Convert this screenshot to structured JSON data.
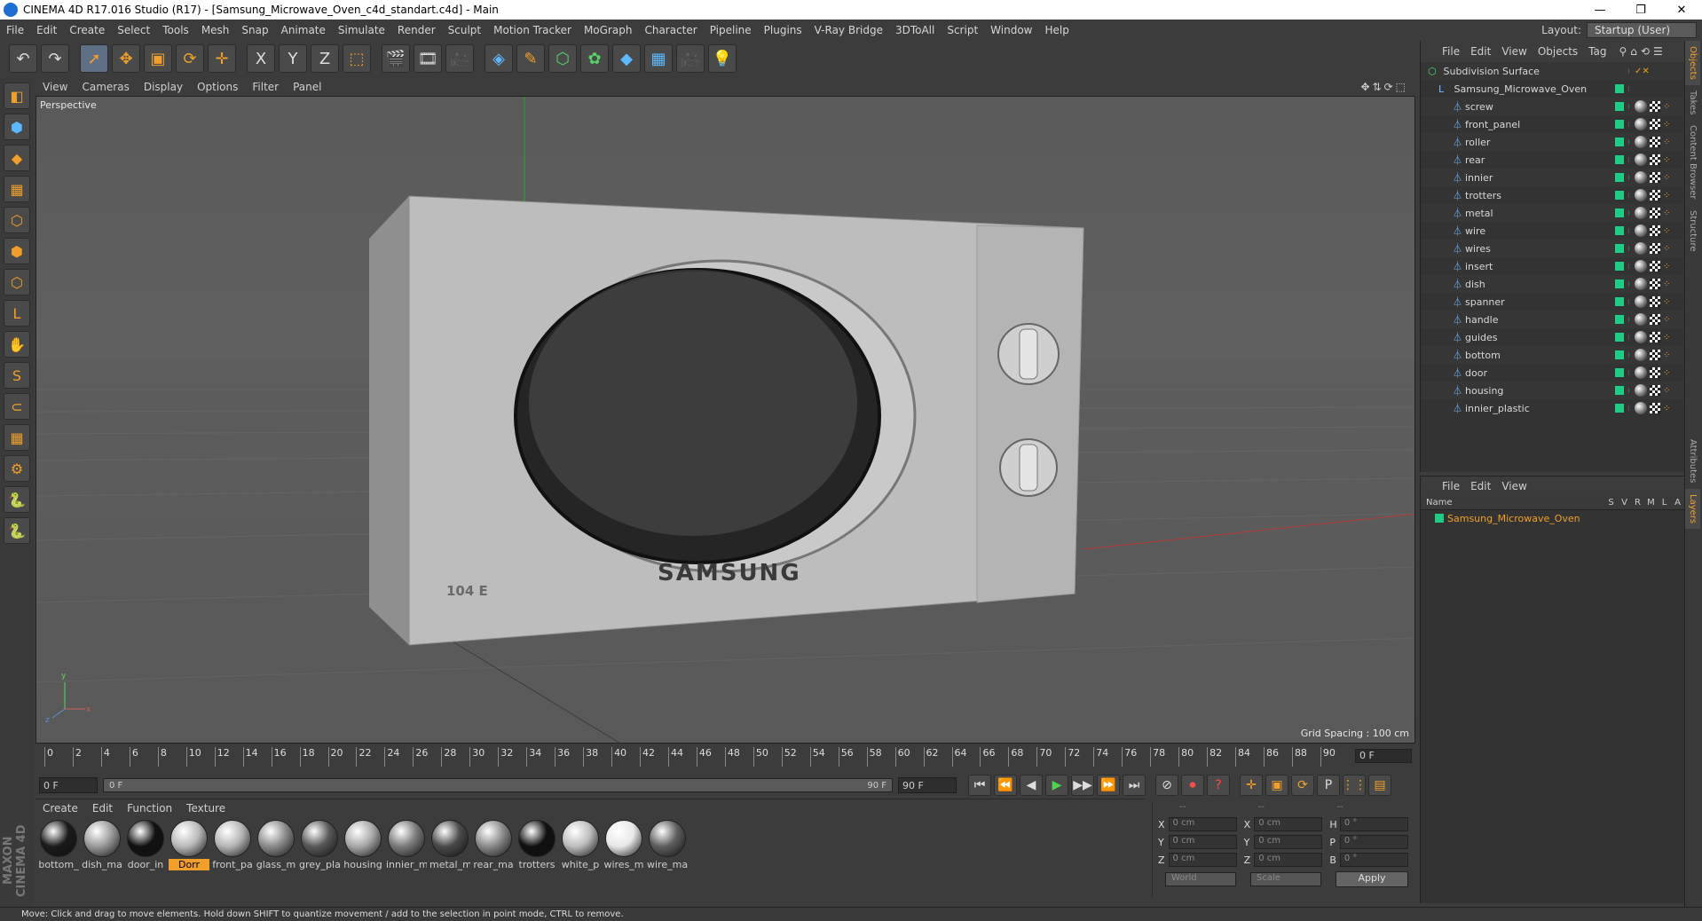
{
  "window": {
    "title": "CINEMA 4D R17.016 Studio (R17) - [Samsung_Microwave_Oven_c4d_standart.c4d] - Main",
    "controls": [
      "—",
      "❐",
      "✕"
    ]
  },
  "menubar": {
    "items": [
      "File",
      "Edit",
      "Create",
      "Select",
      "Tools",
      "Mesh",
      "Snap",
      "Animate",
      "Simulate",
      "Render",
      "Sculpt",
      "Motion Tracker",
      "MoGraph",
      "Character",
      "Pipeline",
      "Plugins",
      "V-Ray Bridge",
      "3DToAll",
      "Script",
      "Window",
      "Help"
    ],
    "layout_label": "Layout:",
    "layout_value": "Startup (User)"
  },
  "toolbar": {
    "undo": "↶",
    "redo": "↷",
    "tools": [
      "➚",
      "✥",
      "▣",
      "⟳",
      "✛"
    ],
    "axes": [
      "X",
      "Y",
      "Z"
    ],
    "coord": "⬚",
    "render": [
      "🎬",
      "🎞",
      "🎥"
    ],
    "objects": [
      "◈",
      "✎",
      "⬡",
      "✿",
      "◆",
      "▦",
      "🎥",
      "💡"
    ]
  },
  "left_tools": [
    "◧",
    "⬢",
    "◆",
    "▦",
    "⬡",
    "⬢",
    "⬡",
    "L",
    "✋",
    "S",
    "⊂",
    "▦",
    "⚙",
    "🐍",
    "🐍"
  ],
  "maxon_logo": "MAXON CINEMA 4D",
  "viewport": {
    "menu": [
      "View",
      "Cameras",
      "Display",
      "Options",
      "Filter",
      "Panel"
    ],
    "nav_icons": "✥⇅⟳⬚",
    "label": "Perspective",
    "grid_spacing": "Grid Spacing : 100 cm",
    "brand_text": "SAMSUNG",
    "badge_text": "104 E",
    "axis_y": "y",
    "axis_z": "z",
    "axis_x": "x"
  },
  "timeline": {
    "ticks": [
      "0",
      "2",
      "4",
      "6",
      "8",
      "10",
      "12",
      "14",
      "16",
      "18",
      "20",
      "22",
      "24",
      "26",
      "28",
      "30",
      "32",
      "34",
      "36",
      "38",
      "40",
      "42",
      "44",
      "46",
      "48",
      "50",
      "52",
      "54",
      "56",
      "58",
      "60",
      "62",
      "64",
      "66",
      "68",
      "70",
      "72",
      "74",
      "76",
      "78",
      "80",
      "82",
      "84",
      "86",
      "88",
      "90"
    ],
    "current": "0 F"
  },
  "transport": {
    "start": "0 F",
    "range_start": "0 F",
    "range_end": "90 F",
    "end": "90 F",
    "buttons": [
      "⏮",
      "⏪",
      "◀",
      "▶",
      "▶▶",
      "⏩",
      "⏭"
    ],
    "rec_buttons": [
      "⊘",
      "⏺",
      "?"
    ],
    "key_buttons": [
      "✛",
      "▣",
      "⟳",
      "P",
      "⋮⋮",
      "▤"
    ]
  },
  "materials": {
    "menu": [
      "Create",
      "Edit",
      "Function",
      "Texture"
    ],
    "items": [
      {
        "label": "bottom_",
        "color": "#1a1a1a"
      },
      {
        "label": "dish_ma",
        "color": "#9a9a9a"
      },
      {
        "label": "door_in",
        "color": "#111111"
      },
      {
        "label": "Dorr",
        "color": "#b9b9b9",
        "selected": true
      },
      {
        "label": "front_pa",
        "color": "#b5b5b5"
      },
      {
        "label": "glass_m",
        "color": "#8a8a8a"
      },
      {
        "label": "grey_pla",
        "color": "#585858"
      },
      {
        "label": "housing",
        "color": "#a8a8a8"
      },
      {
        "label": "innier_m",
        "color": "#7a7a7a"
      },
      {
        "label": "metal_m",
        "color": "#4a4a4a"
      },
      {
        "label": "rear_ma",
        "color": "#8a8a8a"
      },
      {
        "label": "trotters",
        "color": "#101010"
      },
      {
        "label": "white_p",
        "color": "#bdbdbd"
      },
      {
        "label": "wires_m",
        "color": "#e8e8e8"
      },
      {
        "label": "wire_ma",
        "color": "#5e5e5e"
      }
    ]
  },
  "coords": {
    "header": [
      "--",
      "--",
      "--"
    ],
    "rows": [
      {
        "a": "X",
        "av": "0 cm",
        "b": "X",
        "bv": "0 cm",
        "c": "H",
        "cv": "0 °"
      },
      {
        "a": "Y",
        "av": "0 cm",
        "b": "Y",
        "bv": "0 cm",
        "c": "P",
        "cv": "0 °"
      },
      {
        "a": "Z",
        "av": "0 cm",
        "b": "Z",
        "bv": "0 cm",
        "c": "B",
        "cv": "0 °"
      }
    ],
    "space": "World",
    "mode": "Scale",
    "apply": "Apply"
  },
  "objects": {
    "menu": [
      "File",
      "Edit",
      "View",
      "Objects",
      "Tag"
    ],
    "icons": "⚲⌂⟲☰",
    "root": "Subdivision Surface",
    "group": "Samsung_Microwave_Oven",
    "children": [
      "screw",
      "front_panel",
      "roller",
      "rear",
      "innier",
      "trotters",
      "metal",
      "wire",
      "wires",
      "insert",
      "dish",
      "spanner",
      "handle",
      "guides",
      "bottom",
      "door",
      "housing",
      "innier_plastic"
    ]
  },
  "layers": {
    "menu": [
      "File",
      "Edit",
      "View"
    ],
    "columns": [
      "Name",
      "S",
      "V",
      "R",
      "M",
      "L",
      "A"
    ],
    "row": "Samsung_Microwave_Oven"
  },
  "sidetabs": [
    "Objects",
    "Takes",
    "Content Browser",
    "Structure",
    "Attributes",
    "Layers"
  ],
  "status": "Move: Click and drag to move elements. Hold down SHIFT to quantize movement / add to the selection in point mode, CTRL to remove.",
  "colors": {
    "accent": "#f0a02a",
    "layer_green": "#1fcb85"
  }
}
